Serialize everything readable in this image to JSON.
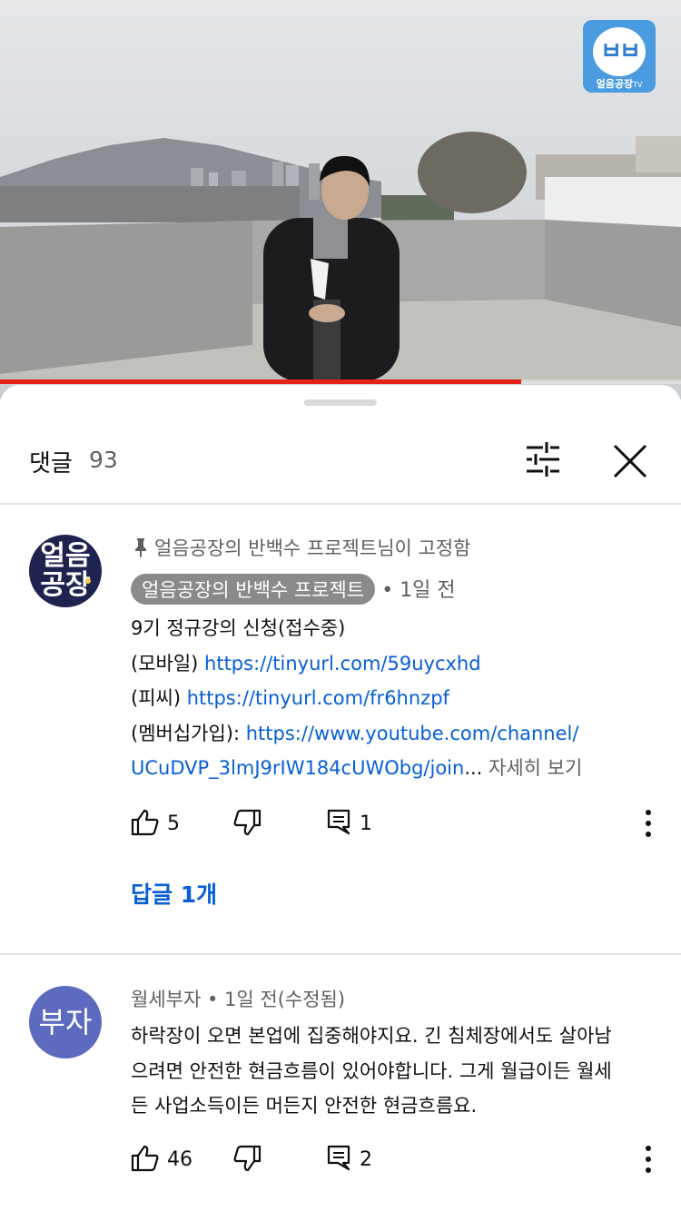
{
  "video": {
    "watermark": "얼음공장",
    "watermark_glyph": "ㅂㅂ",
    "watermark_tv": "TV",
    "progress": 0.765,
    "progress_color": "#e62117"
  },
  "comments_sheet": {
    "title": "댓글",
    "count": "93",
    "sort_icon": "sort-filter-icon",
    "close_icon": "close-icon"
  },
  "comments": [
    {
      "avatar_lines": [
        "얼음",
        "공장"
      ],
      "pinned_text": "얼음공장의 반백수 프로젝트님이 고정함",
      "author": "얼음공장의 반백수 프로젝트",
      "time": "• 1일 전",
      "lines": [
        {
          "prefix": "9기 정규강의 신청(접수중)"
        },
        {
          "prefix": "(모바일) ",
          "link": "https://tinyurl.com/59uycxhd"
        },
        {
          "prefix": "(피씨) ",
          "link": "https://tinyurl.com/fr6hnzpf"
        },
        {
          "prefix": "(멤버십가입): ",
          "link": "https://www.youtube.com/channel/"
        },
        {
          "link": "UCuDVP_3lmJ9rIW184cUWObg/join",
          "suffix": "...",
          "more": " 자세히 보기"
        }
      ],
      "likes": "5",
      "replies": "1",
      "replies_button": "답글 1개"
    },
    {
      "avatar_text": "부자",
      "author": "월세부자",
      "time": "• 1일 전(수정됨)",
      "lines": [
        "하락장이 오면 본업에 집중해야지요. 긴 침체장에서도 살아남",
        "으려면 안전한 현금흐름이 있어야합니다. 그게 월급이든 월세",
        "든 사업소득이든 머든지 안전한 현금흐름요."
      ],
      "likes": "46",
      "replies": "2"
    }
  ]
}
